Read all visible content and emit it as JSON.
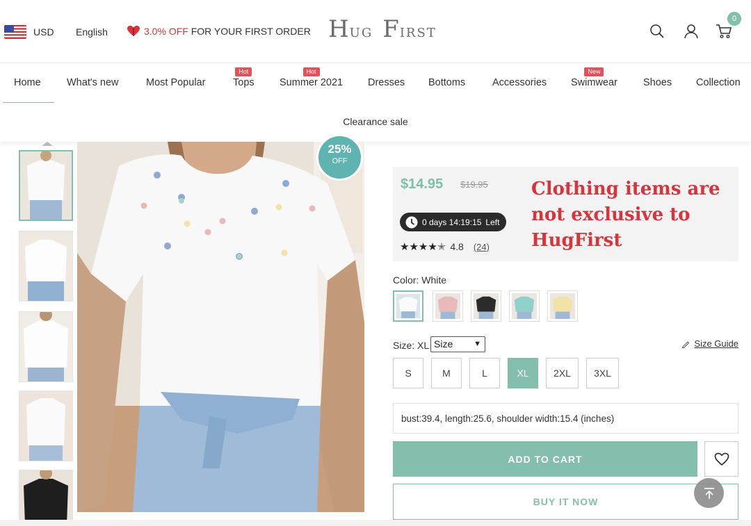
{
  "topbar": {
    "currency": "USD",
    "language": "English",
    "promo_percent": "3.0% OFF",
    "promo_rest": "FOR YOUR FIRST ORDER",
    "logo_h": "H",
    "logo_ug": "UG",
    "logo_f": "F",
    "logo_irst": "IRST",
    "cart_count": "0",
    "icons": [
      "flag-us-icon",
      "heart-gift-icon",
      "search-icon",
      "user-icon",
      "cart-icon"
    ]
  },
  "nav": {
    "items": [
      {
        "label": "Home",
        "tag": ""
      },
      {
        "label": "What's new",
        "tag": ""
      },
      {
        "label": "Most Popular",
        "tag": ""
      },
      {
        "label": "Tops",
        "tag": "Hot"
      },
      {
        "label": "Summer 2021",
        "tag": "Hot"
      },
      {
        "label": "Dresses",
        "tag": ""
      },
      {
        "label": "Bottoms",
        "tag": ""
      },
      {
        "label": "Accessories",
        "tag": ""
      },
      {
        "label": "Swimwear",
        "tag": "New"
      },
      {
        "label": "Shoes",
        "tag": ""
      },
      {
        "label": "Collection",
        "tag": ""
      }
    ],
    "row2": "Clearance sale"
  },
  "product": {
    "discount_pct": "25%",
    "discount_word": "OFF",
    "price": "$14.95",
    "old_price": "$19.95",
    "timer": "0 days 14:19:15",
    "timer_suffix": "Left",
    "rating": "4.8",
    "reviews": "(24)",
    "notice": "Clothing items are not exclusive to HugFirst",
    "color_label": "Color: White",
    "colors": [
      {
        "name": "White",
        "hex": "#f5f5f5"
      },
      {
        "name": "Pink",
        "hex": "#e9b9b9"
      },
      {
        "name": "Black",
        "hex": "#2a2a2a"
      },
      {
        "name": "Aqua",
        "hex": "#8fd0cd"
      },
      {
        "name": "Yellow",
        "hex": "#f2e2a8"
      }
    ],
    "size_label": "Size: XL",
    "size_select": "Size",
    "size_guide": "Size Guide",
    "sizes": [
      "S",
      "M",
      "L",
      "XL",
      "2XL",
      "3XL"
    ],
    "selected_size": "XL",
    "measurements": "bust:39.4, length:25.6, shoulder width:15.4 (inches)",
    "add_to_cart": "ADD TO CART",
    "buy_now": "BUY IT NOW"
  },
  "colors": {
    "accent": "#83bfac",
    "badge": "#5fb3b0",
    "hot_tag": "#e0535b",
    "notice_red": "#d9343b"
  }
}
